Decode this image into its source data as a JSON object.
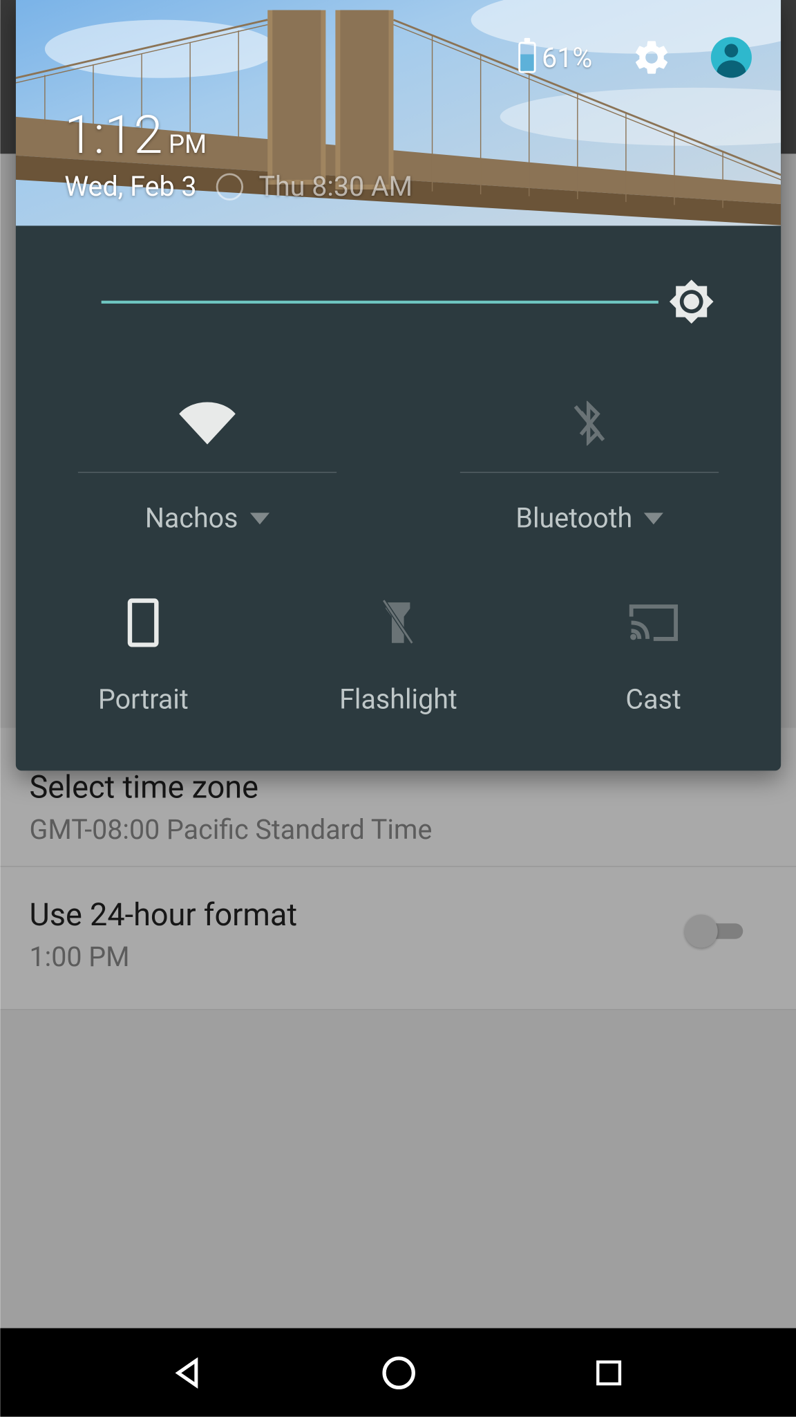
{
  "status": {
    "battery_pct": "61%"
  },
  "time": {
    "value": "1:12",
    "ampm": "PM",
    "date": "Wed, Feb 3",
    "alarm": "Thu 8:30 AM"
  },
  "brightness": {
    "value": 100
  },
  "tiles": {
    "wifi": {
      "label": "Nachos",
      "active": true
    },
    "bluetooth": {
      "label": "Bluetooth",
      "active": false
    },
    "portrait": {
      "label": "Portrait"
    },
    "flashlight": {
      "label": "Flashlight"
    },
    "cast": {
      "label": "Cast"
    }
  },
  "settings_bg": {
    "timezone": {
      "title": "Select time zone",
      "sub": "GMT-08:00 Pacific Standard Time"
    },
    "format24": {
      "title": "Use 24-hour format",
      "sub": "1:00 PM"
    }
  },
  "colors": {
    "panel": "#2C3A3F",
    "accent": "#6EC5C0"
  }
}
